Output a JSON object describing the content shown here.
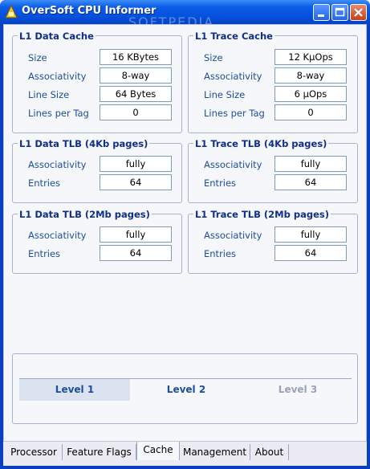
{
  "window": {
    "title": "OverSoft CPU Informer",
    "watermark": "SOFTPEDIA"
  },
  "groups": {
    "l1_data_cache": {
      "title": "L1 Data Cache",
      "rows": [
        {
          "label": "Size",
          "value": "16 KBytes"
        },
        {
          "label": "Associativity",
          "value": "8-way"
        },
        {
          "label": "Line Size",
          "value": "64 Bytes"
        },
        {
          "label": "Lines per Tag",
          "value": "0"
        }
      ]
    },
    "l1_trace_cache": {
      "title": "L1 Trace Cache",
      "rows": [
        {
          "label": "Size",
          "value": "12 KµOps"
        },
        {
          "label": "Associativity",
          "value": "8-way"
        },
        {
          "label": "Line Size",
          "value": "6 µOps"
        },
        {
          "label": "Lines per Tag",
          "value": "0"
        }
      ]
    },
    "l1_data_tlb_4kb": {
      "title": "L1 Data TLB (4Kb pages)",
      "rows": [
        {
          "label": "Associativity",
          "value": "fully"
        },
        {
          "label": "Entries",
          "value": "64"
        }
      ]
    },
    "l1_trace_tlb_4kb": {
      "title": "L1 Trace TLB (4Kb pages)",
      "rows": [
        {
          "label": "Associativity",
          "value": "fully"
        },
        {
          "label": "Entries",
          "value": "64"
        }
      ]
    },
    "l1_data_tlb_2mb": {
      "title": "L1 Data TLB (2Mb pages)",
      "rows": [
        {
          "label": "Associativity",
          "value": "fully"
        },
        {
          "label": "Entries",
          "value": "64"
        }
      ]
    },
    "l1_trace_tlb_2mb": {
      "title": "L1 Trace TLB (2Mb pages)",
      "rows": [
        {
          "label": "Associativity",
          "value": "fully"
        },
        {
          "label": "Entries",
          "value": "64"
        }
      ]
    }
  },
  "levels": [
    {
      "label": "Level 1",
      "state": "selected"
    },
    {
      "label": "Level 2",
      "state": "normal"
    },
    {
      "label": "Level 3",
      "state": "disabled"
    }
  ],
  "tabs": [
    {
      "label": "Processor",
      "active": false
    },
    {
      "label": "Feature Flags",
      "active": false
    },
    {
      "label": "Cache",
      "active": true
    },
    {
      "label": "Management",
      "active": false
    },
    {
      "label": "About",
      "active": false
    }
  ],
  "colors": {
    "title_bar": "#0550dc",
    "group_title": "#0f2f8a",
    "label": "#1d4e9d",
    "level_selected_bg": "#dbe3f0",
    "level_text": "#1d4e9d",
    "level_disabled_text": "#9aa3b5"
  }
}
